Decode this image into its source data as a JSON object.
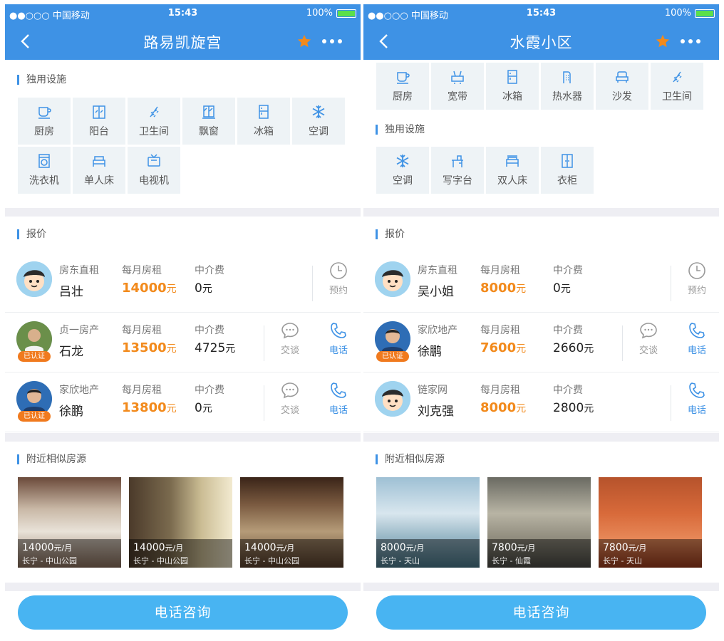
{
  "status": {
    "carrier": "●●○○○ 中国移动",
    "time": "15:43",
    "battery": "100%"
  },
  "left": {
    "title": "路易凯旋宫",
    "facilities": {
      "title": "独用设施",
      "items": [
        {
          "label": "厨房",
          "icon": "cup-icon"
        },
        {
          "label": "阳台",
          "icon": "balcony-icon"
        },
        {
          "label": "卫生间",
          "icon": "shower-icon"
        },
        {
          "label": "飘窗",
          "icon": "window-icon"
        },
        {
          "label": "冰箱",
          "icon": "fridge-icon"
        },
        {
          "label": "空调",
          "icon": "snowflake-icon"
        },
        {
          "label": "洗衣机",
          "icon": "washer-icon"
        },
        {
          "label": "单人床",
          "icon": "bed-icon"
        },
        {
          "label": "电视机",
          "icon": "tv-icon"
        }
      ]
    },
    "quote": {
      "title": "报价",
      "rows": [
        {
          "source": "房东直租",
          "name": "吕壮",
          "rent_label": "每月房租",
          "rent": "14000",
          "unit": "元",
          "fee_label": "中介费",
          "fee": "0",
          "actions": [
            "预约"
          ],
          "verified": ""
        },
        {
          "source": "贞一房产",
          "name": "石龙",
          "rent_label": "每月房租",
          "rent": "13500",
          "unit": "元",
          "fee_label": "中介费",
          "fee": "4725",
          "actions": [
            "交谈",
            "电话"
          ],
          "verified": "已认证"
        },
        {
          "source": "家欣地产",
          "name": "徐鹏",
          "rent_label": "每月房租",
          "rent": "13800",
          "unit": "元",
          "fee_label": "中介费",
          "fee": "0",
          "actions": [
            "交谈",
            "电话"
          ],
          "verified": "已认证"
        }
      ]
    },
    "nearby": {
      "title": "附近相似房源",
      "items": [
        {
          "price": "14000",
          "unit": "元/月",
          "location": "长宁 - 中山公园"
        },
        {
          "price": "14000",
          "unit": "元/月",
          "location": "长宁 - 中山公园"
        },
        {
          "price": "14000",
          "unit": "元/月",
          "location": "长宁 - 中山公园"
        }
      ]
    },
    "cta": "电话咨询"
  },
  "right": {
    "title": "水霞小区",
    "shared_items": [
      {
        "label": "厨房",
        "icon": "cup-icon"
      },
      {
        "label": "宽带",
        "icon": "router-icon"
      },
      {
        "label": "冰箱",
        "icon": "fridge-icon"
      },
      {
        "label": "热水器",
        "icon": "heater-icon"
      },
      {
        "label": "沙发",
        "icon": "sofa-icon"
      },
      {
        "label": "卫生间",
        "icon": "shower-icon"
      }
    ],
    "facilities": {
      "title": "独用设施",
      "items": [
        {
          "label": "空调",
          "icon": "snowflake-icon"
        },
        {
          "label": "写字台",
          "icon": "desk-icon"
        },
        {
          "label": "双人床",
          "icon": "double-bed-icon"
        },
        {
          "label": "衣柜",
          "icon": "wardrobe-icon"
        }
      ]
    },
    "quote": {
      "title": "报价",
      "rows": [
        {
          "source": "房东直租",
          "name": "吴小姐",
          "rent_label": "每月房租",
          "rent": "8000",
          "unit": "元",
          "fee_label": "中介费",
          "fee": "0",
          "actions": [
            "预约"
          ],
          "verified": ""
        },
        {
          "source": "家欣地产",
          "name": "徐鹏",
          "rent_label": "每月房租",
          "rent": "7600",
          "unit": "元",
          "fee_label": "中介费",
          "fee": "2660",
          "actions": [
            "交谈",
            "电话"
          ],
          "verified": "已认证"
        },
        {
          "source": "链家网",
          "name": "刘克强",
          "rent_label": "每月房租",
          "rent": "8000",
          "unit": "元",
          "fee_label": "中介费",
          "fee": "2800",
          "actions": [
            "电话"
          ],
          "verified": ""
        }
      ]
    },
    "nearby": {
      "title": "附近相似房源",
      "items": [
        {
          "price": "8000",
          "unit": "元/月",
          "location": "长宁 - 天山"
        },
        {
          "price": "7800",
          "unit": "元/月",
          "location": "长宁 - 仙霞"
        },
        {
          "price": "7800",
          "unit": "元/月",
          "location": "长宁 - 天山"
        }
      ]
    },
    "cta": "电话咨询"
  },
  "colors": {
    "accent": "#3e92e5",
    "price": "#f28a1c",
    "cta": "#48b4f2",
    "tile_bg": "#eef3f6"
  }
}
